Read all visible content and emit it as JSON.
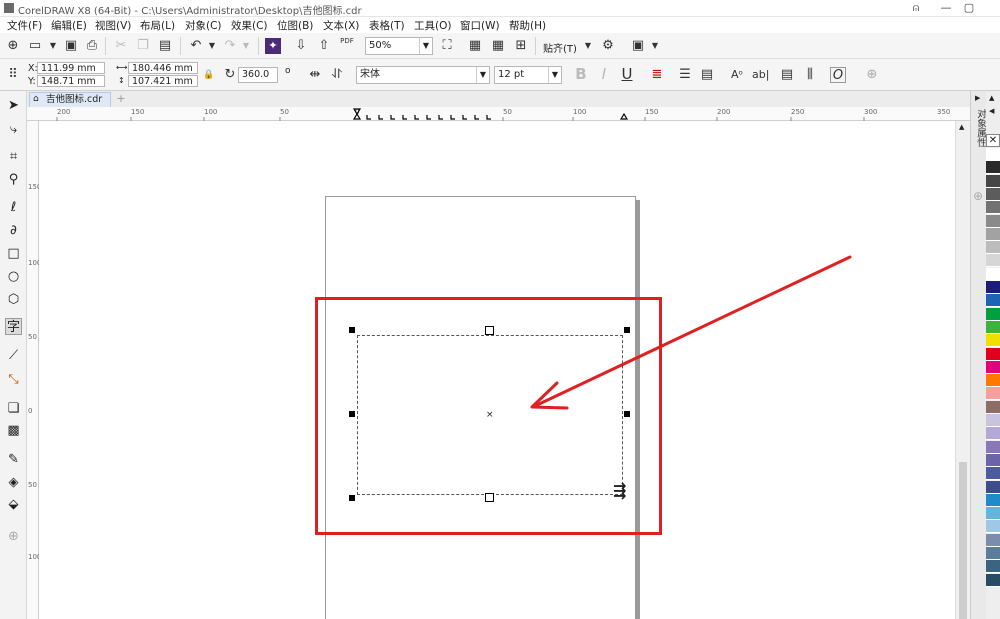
{
  "window": {
    "title": "CorelDRAW X8 (64-Bit) - C:\\Users\\Administrator\\Desktop\\吉他图标.cdr",
    "min_glyph": "—",
    "max_glyph": "▢",
    "user_glyph": "⍝"
  },
  "menu": [
    "文件(F)",
    "编辑(E)",
    "视图(V)",
    "布局(L)",
    "对象(C)",
    "效果(C)",
    "位图(B)",
    "文本(X)",
    "表格(T)",
    "工具(O)",
    "窗口(W)",
    "帮助(H)"
  ],
  "toolbar": {
    "zoom": "50%",
    "snap_label": "贴齐(T)",
    "pdf_label": "PDF"
  },
  "property_bar": {
    "x_label": "X:",
    "x_value": "111.99 mm",
    "y_label": "Y:",
    "y_value": "148.71 mm",
    "width_value": "180.446 mm",
    "height_value": "107.421 mm",
    "rotation_value": "360.0",
    "rotation_unit": "o",
    "font_name": "宋体",
    "font_size": "12 pt",
    "bold": "B",
    "italic": "I",
    "underline": "U"
  },
  "document_tab": {
    "label": "吉他图标.cdr",
    "add": "+"
  },
  "ruler": {
    "h_ticks": [
      "200",
      "150",
      "100",
      "50",
      "0",
      "50",
      "100",
      "150",
      "200",
      "250",
      "300",
      "350"
    ],
    "v_ticks": [
      "150",
      "100",
      "50",
      "0",
      "50",
      "100"
    ]
  },
  "docker": {
    "title": "对象属性"
  },
  "palette": {
    "colors": [
      "#ffffff",
      "#2a2a2a",
      "#464646",
      "#5c5c5c",
      "#727272",
      "#8a8a8a",
      "#a2a2a2",
      "#bcbcbc",
      "#d6d6d6",
      "#ffffff",
      "#1c1c7c",
      "#1e64b4",
      "#00a040",
      "#3cb43c",
      "#f0e000",
      "#e00020",
      "#e4007c",
      "#ff7800",
      "#f4a0a0",
      "#8c6c64",
      "#c8c4e0",
      "#b4a8d8",
      "#8878b8",
      "#6c64a8",
      "#4c5c9c",
      "#3c4c8c",
      "#1e8cc8",
      "#64b4dc",
      "#a0c8e4",
      "#7c8cac",
      "#5c7c9c",
      "#3c6480",
      "#284c64"
    ]
  },
  "colors": {
    "accent_red": "#e02020",
    "tab_blue": "#dfe9f5"
  }
}
